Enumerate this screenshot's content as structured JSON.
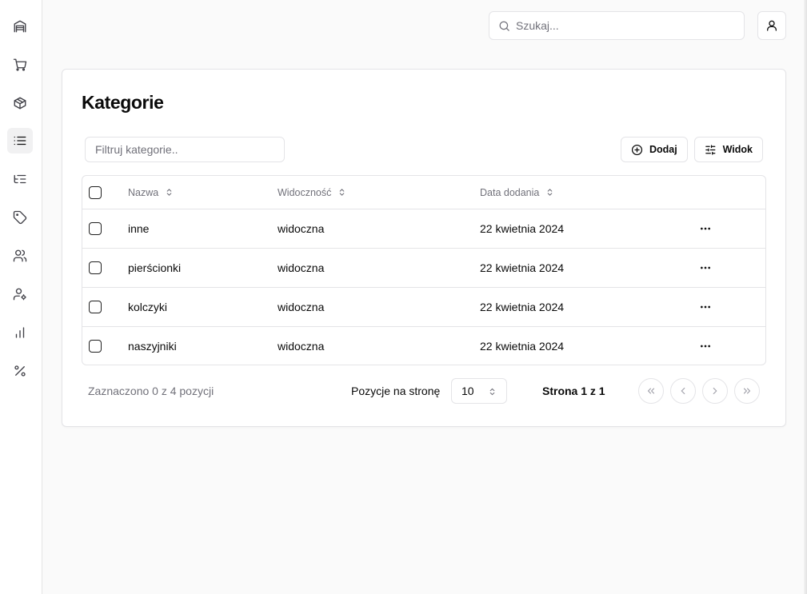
{
  "sidebar": {
    "items": [
      {
        "icon": "warehouse-icon",
        "active": false
      },
      {
        "icon": "shopping-cart-icon",
        "active": false
      },
      {
        "icon": "package-icon",
        "active": false
      },
      {
        "icon": "list-icon",
        "active": true
      },
      {
        "icon": "list-tree-icon",
        "active": false
      },
      {
        "icon": "tag-icon",
        "active": false
      },
      {
        "icon": "users-icon",
        "active": false
      },
      {
        "icon": "user-cog-icon",
        "active": false
      },
      {
        "icon": "bar-chart-icon",
        "active": false
      },
      {
        "icon": "percent-icon",
        "active": false
      }
    ]
  },
  "header": {
    "search_placeholder": "Szukaj..."
  },
  "page": {
    "title": "Kategorie",
    "filter_placeholder": "Filtruj kategorie..",
    "add_label": "Dodaj",
    "view_label": "Widok"
  },
  "table": {
    "columns": {
      "name": "Nazwa",
      "visibility": "Widoczność",
      "date": "Data dodania"
    },
    "rows": [
      {
        "name": "inne",
        "visibility": "widoczna",
        "date": "22 kwietnia 2024"
      },
      {
        "name": "pierścionki",
        "visibility": "widoczna",
        "date": "22 kwietnia 2024"
      },
      {
        "name": "kolczyki",
        "visibility": "widoczna",
        "date": "22 kwietnia 2024"
      },
      {
        "name": "naszyjniki",
        "visibility": "widoczna",
        "date": "22 kwietnia 2024"
      }
    ]
  },
  "footer": {
    "selected_text": "Zaznaczono 0 z 4 pozycji",
    "per_page_label": "Pozycje na stronę",
    "per_page_value": "10",
    "page_info": "Strona 1 z 1"
  },
  "colors": {
    "border": "#e4e4e7",
    "muted_text": "#71717a",
    "active_nav": "#f1f1f2"
  }
}
